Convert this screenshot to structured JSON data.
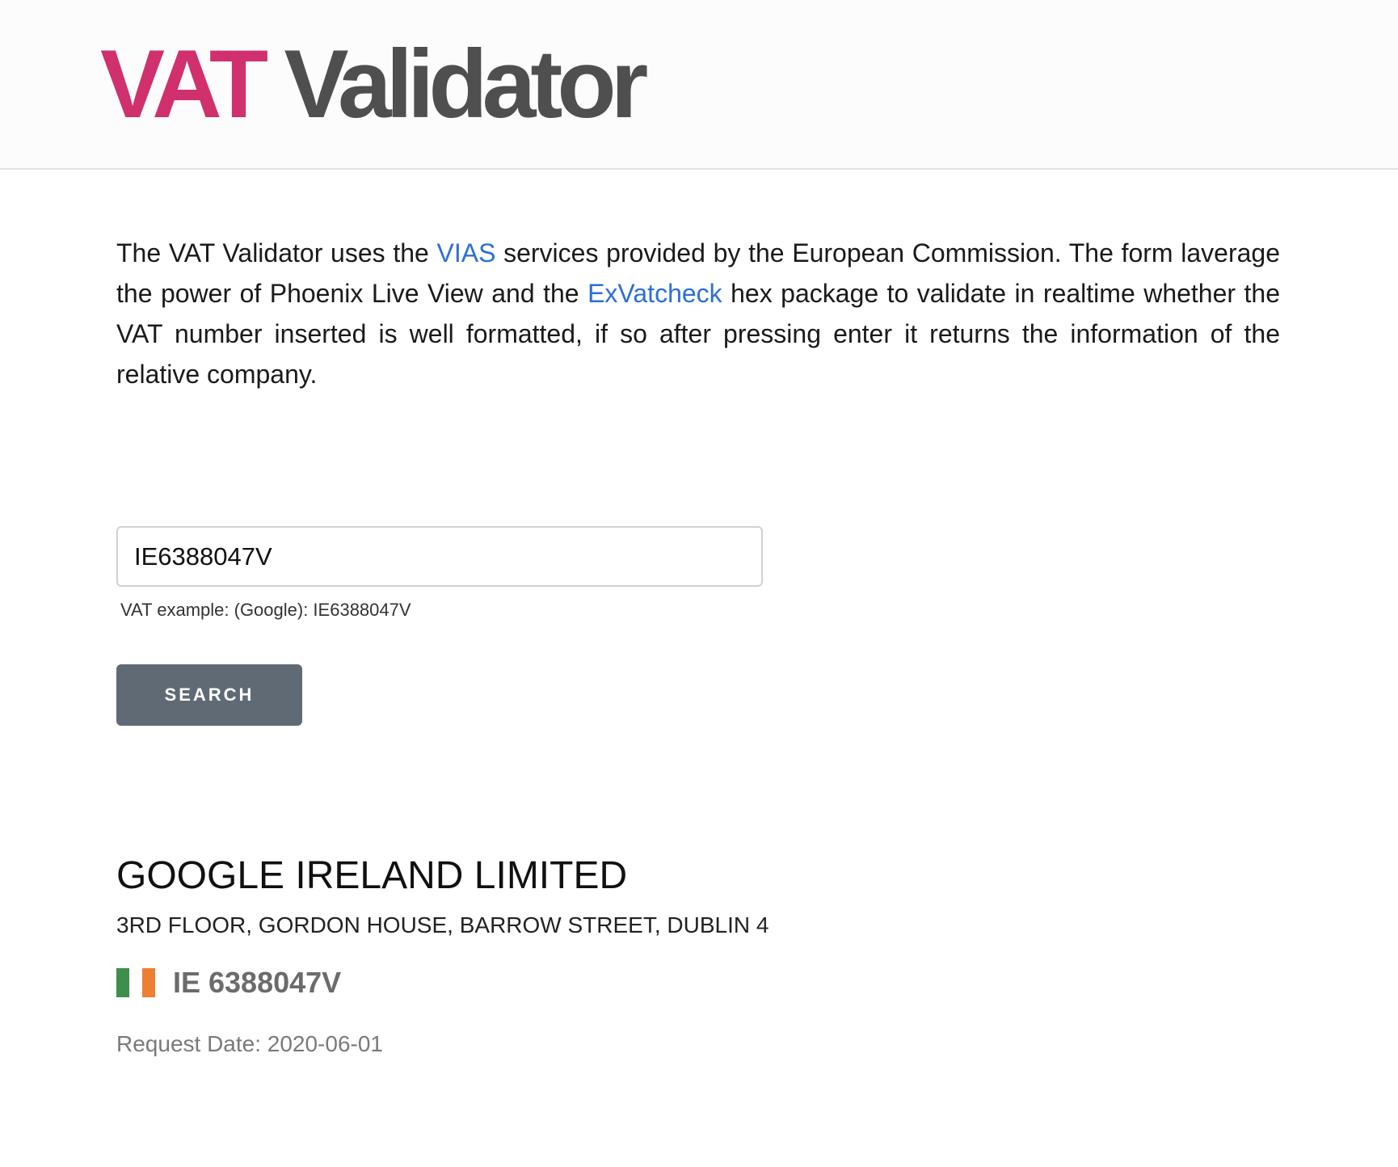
{
  "header": {
    "logo_accent": "VAT",
    "logo_rest": " Validator"
  },
  "intro": {
    "part1": "The VAT Validator uses the ",
    "link1": "VIAS",
    "part2": " services provided by the European Commission. The form laverage the power of Phoenix Live View and the ",
    "link2": "ExVatcheck",
    "part3": " hex package to validate in realtime whether the VAT number inserted is well formatted, if so after pressing enter it returns the information of the relative company."
  },
  "form": {
    "vat_value": "IE6388047V",
    "hint": "VAT example: (Google): IE6388047V",
    "search_label": "SEARCH"
  },
  "result": {
    "company_name": "GOOGLE IRELAND LIMITED",
    "address": "3RD FLOOR, GORDON HOUSE, BARROW STREET, DUBLIN 4",
    "vat_number": "IE 6388047V",
    "request_date": "Request Date: 2020-06-01",
    "flag": {
      "icon": "ireland-flag-icon",
      "colors": [
        "#3e8e4c",
        "#ffffff",
        "#ec7f33"
      ]
    }
  },
  "colors": {
    "accent": "#d0306e",
    "link": "#2c6fd6",
    "button": "#606a74"
  }
}
